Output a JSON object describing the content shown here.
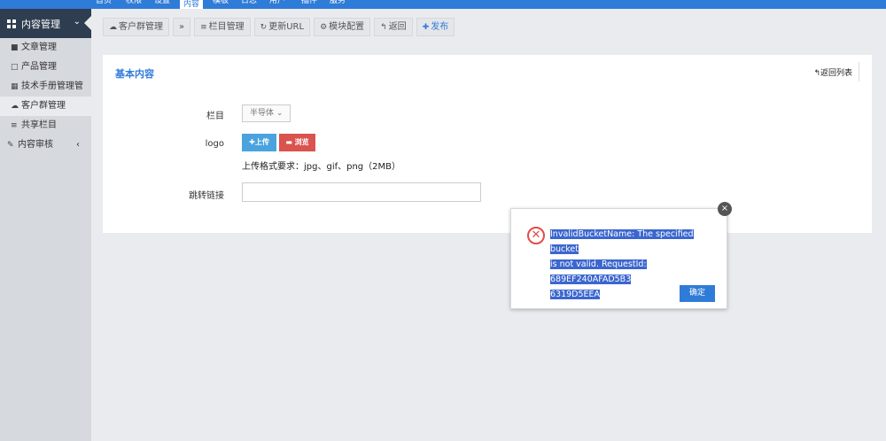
{
  "topnav": {
    "items": [
      "首页",
      "权限",
      "设置",
      "内容",
      "模板",
      "日志",
      "用户",
      "插件",
      "服务"
    ],
    "active_index": 3
  },
  "sidebar": {
    "header": "内容管理",
    "items": [
      {
        "label": "文章管理",
        "icon": "book-icon"
      },
      {
        "label": "产品管理",
        "icon": "bag-icon"
      },
      {
        "label": "技术手册管理管",
        "icon": "table-icon"
      },
      {
        "label": "客户群管理",
        "icon": "cloud-icon",
        "active": true
      },
      {
        "label": "共享栏目",
        "icon": "list-icon"
      }
    ],
    "audit": "内容审核"
  },
  "toolbar": {
    "customer": "客户群管理",
    "expand": "»",
    "columns": "栏目管理",
    "update_url": "更新URL",
    "module_config": "模块配置",
    "back": "返回",
    "publish": "发布"
  },
  "panel": {
    "title": "基本内容",
    "back_list": "返回列表",
    "column_label": "栏目",
    "column_value": "半导体",
    "logo_label": "logo",
    "upload_label": "上传",
    "browse_label": "浏览",
    "upload_hint": "上传格式要求：jpg、gif、png（2MB）",
    "link_label": "跳转链接",
    "link_value": ""
  },
  "dialog": {
    "message_line1": "InvalidBucketName: The specified bucket",
    "message_line2": "is not valid. RequestId: 689EF240AFAD5B3",
    "message_line3": "6319D5EEA",
    "ok_label": "确定",
    "close_icon": "×"
  },
  "colors": {
    "accent": "#2f7bd8",
    "sidebar_head": "#2e3d50",
    "sidebar_bg": "#d6d9de",
    "error": "#e34b4b",
    "browse": "#d9534f",
    "upload": "#4aa3df"
  }
}
